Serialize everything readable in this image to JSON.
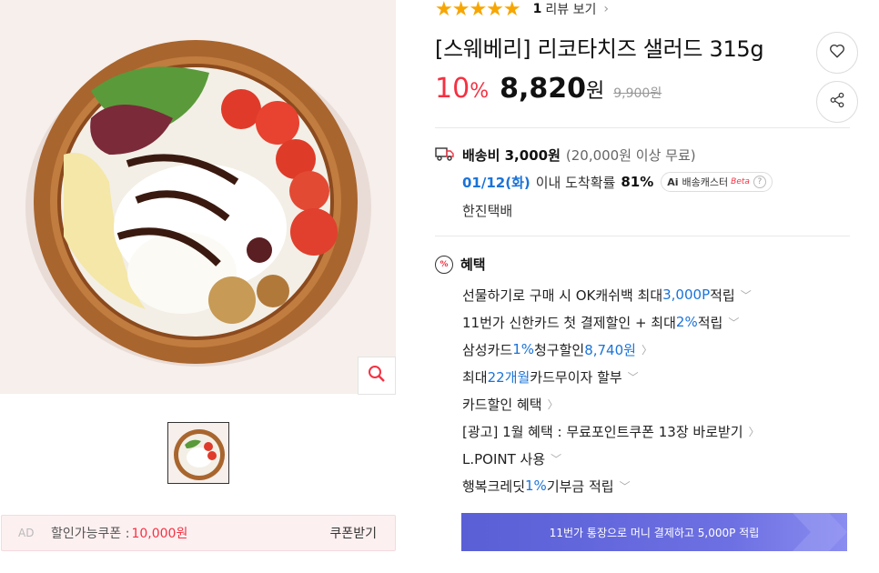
{
  "rating": {
    "stars": "★★★★★",
    "review_count": "1",
    "review_link": "리뷰 보기"
  },
  "product": {
    "title": "[스웨베리] 리코타치즈 샐러드 315g",
    "discount": "10",
    "discount_unit": "%",
    "price": "8,820",
    "price_unit": "원",
    "original_price": "9,900원"
  },
  "shipping": {
    "fee": "배송비 3,000원",
    "condition": "(20,000원 이상 무료)",
    "date": "01/12(화)",
    "date_text": "이내 도착확률",
    "probability": "81%",
    "ai_label": "Ai",
    "ai_text": "배송캐스터",
    "ai_beta": "Beta",
    "carrier": "한진택배"
  },
  "benefits": {
    "heading": "혜택",
    "items": [
      {
        "pre": "선물하기로 구매 시 OK캐쉬백 최대 ",
        "hl": "3,000P",
        "post": " 적립",
        "chev": "﹀"
      },
      {
        "pre": "11번가 신한카드 첫 결제할인 + 최대 ",
        "hl": "2%",
        "post": " 적립",
        "chev": "﹀"
      },
      {
        "pre": "삼성카드 ",
        "hl": "1%",
        "post": " 청구할인 ",
        "hl2": "8,740원",
        "chev": "〉"
      },
      {
        "pre": "최대 ",
        "hl": "22개월",
        "post": " 카드무이자 할부",
        "chev": "﹀"
      },
      {
        "pre": "카드할인 혜택",
        "hl": "",
        "post": "",
        "chev": "〉"
      },
      {
        "pre": "[광고] 1월 혜택 : 무료포인트쿠폰 13장 바로받기",
        "hl": "",
        "post": "",
        "chev": "〉"
      },
      {
        "pre": "L.POINT 사용",
        "hl": "",
        "post": "",
        "chev": "﹀"
      },
      {
        "pre": "행복크레딧 ",
        "hl": "1%",
        "post": " 기부금 적립",
        "chev": "﹀"
      }
    ]
  },
  "coupon": {
    "ad_label": "AD",
    "label": "할인가능쿠폰 : ",
    "amount": "10,000원",
    "receive": "쿠폰받기"
  },
  "banner": {
    "text": "11번가 통장으로 머니 결제하고 5,000P 적립"
  },
  "icons": {
    "zoom": "search-icon",
    "like": "heart-icon",
    "share": "share-icon",
    "truck": "truck-icon",
    "percent": "percent-icon"
  },
  "colors": {
    "accent_red": "#f43142",
    "accent_blue": "#1a73d9",
    "star": "#f7a600",
    "banner": "#5a5fd6"
  }
}
